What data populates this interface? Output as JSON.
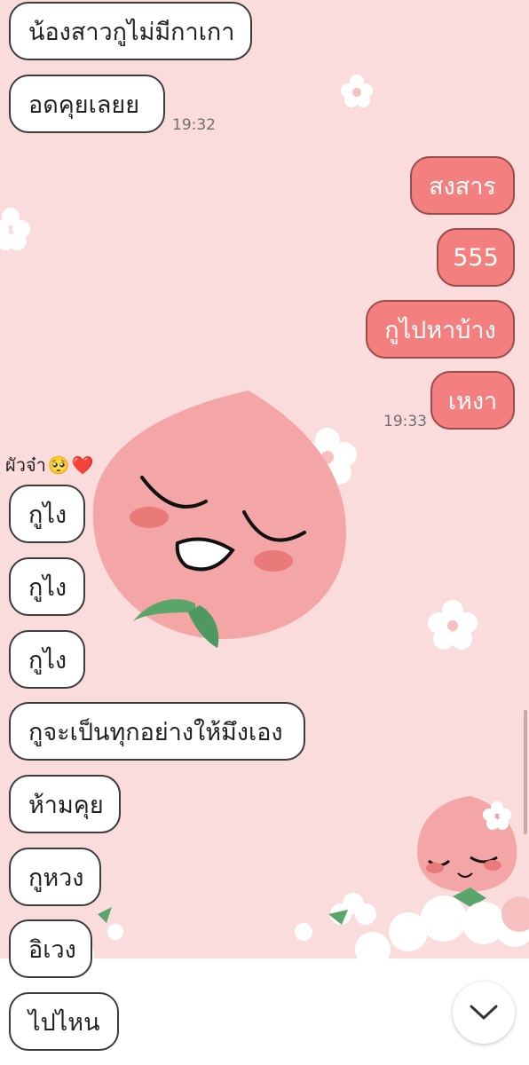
{
  "chat": {
    "incoming_top": [
      {
        "text": "น้องสาวกูไม่มีกาเกา"
      },
      {
        "text": "อดคุยเลยย"
      }
    ],
    "time_1": "19:32",
    "outgoing": [
      {
        "text": "สงสาร"
      },
      {
        "text": "555"
      },
      {
        "text": "กูไปหาบ้าง"
      },
      {
        "text": "เหงา"
      }
    ],
    "time_2": "19:33",
    "sender_name": "ผัวจ๋า",
    "sender_emojis": [
      "🥺",
      "❤️"
    ],
    "incoming_bottom": [
      {
        "text": "กูไง"
      },
      {
        "text": "กูไง"
      },
      {
        "text": "กูไง"
      },
      {
        "text": "กูจะเป็นทุกอย่างให้มึงเอง"
      },
      {
        "text": "ห้ามคุย"
      },
      {
        "text": "กูหวง"
      },
      {
        "text": "อิเวง"
      },
      {
        "text": "ไปไหน"
      }
    ]
  },
  "theme": {
    "background": "#fbdcdc",
    "outgoing_bubble": "#f47f7f",
    "incoming_bubble": "#ffffff"
  },
  "icons": {
    "scroll_down": "chevron-down-icon"
  }
}
